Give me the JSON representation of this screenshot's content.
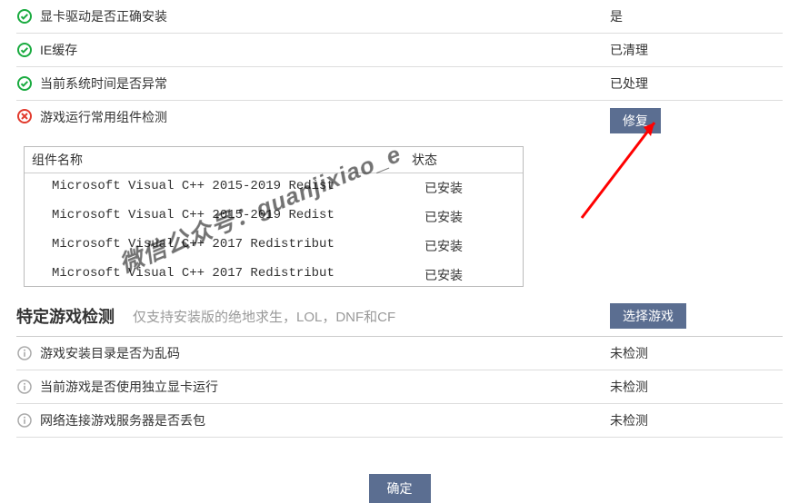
{
  "checks": [
    {
      "icon": "ok",
      "label": "显卡驱动是否正确安装",
      "status": "是"
    },
    {
      "icon": "ok",
      "label": "IE缓存",
      "status": "已清理"
    },
    {
      "icon": "ok",
      "label": "当前系统时间是否异常",
      "status": "已处理"
    }
  ],
  "component_check": {
    "icon": "err",
    "label": "游戏运行常用组件检测",
    "action": "修复",
    "table": {
      "headers": {
        "name": "组件名称",
        "status": "状态"
      },
      "rows": [
        {
          "name": "Microsoft Visual C++ 2015-2019 Redist",
          "status": "已安装"
        },
        {
          "name": "Microsoft Visual C++ 2015-2019 Redist",
          "status": "已安装"
        },
        {
          "name": "Microsoft Visual C++ 2017 Redistribut",
          "status": "已安装"
        },
        {
          "name": "Microsoft Visual C++ 2017 Redistribut",
          "status": "已安装"
        }
      ]
    }
  },
  "game_section": {
    "title": "特定游戏检测",
    "hint": "仅支持安装版的绝地求生，LOL，DNF和CF",
    "action": "选择游戏",
    "items": [
      {
        "label": "游戏安装目录是否为乱码",
        "status": "未检测"
      },
      {
        "label": "当前游戏是否使用独立显卡运行",
        "status": "未检测"
      },
      {
        "label": "网络连接游戏服务器是否丢包",
        "status": "未检测"
      }
    ]
  },
  "footer": {
    "confirm": "确定"
  },
  "watermark": "微信公众号：guanjixiao_e"
}
